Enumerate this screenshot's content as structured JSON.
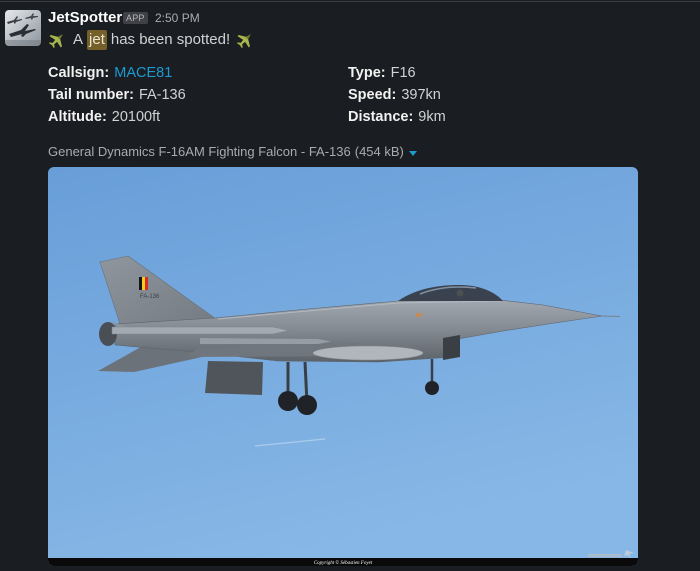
{
  "app": {
    "name": "JetSpotter",
    "badge": "APP",
    "time": "2:50 PM",
    "avatar_icon": "jets-avatar-icon"
  },
  "message": {
    "prefix": "A",
    "highlight": "jet",
    "suffix": "has been spotted!",
    "icon": "airplane-icon"
  },
  "fields": {
    "callsign": {
      "label": "Callsign:",
      "value": "MACE81"
    },
    "tail_number": {
      "label": "Tail number:",
      "value": "FA-136"
    },
    "altitude": {
      "label": "Altitude:",
      "value": "20100ft"
    },
    "type": {
      "label": "Type:",
      "value": "F16"
    },
    "speed": {
      "label": "Speed:",
      "value": "397kn"
    },
    "distance": {
      "label": "Distance:",
      "value": "9km"
    }
  },
  "attachment": {
    "title": "General Dynamics F-16AM Fighting Falcon - FA-136",
    "size": "(454 kB)",
    "toggle_icon": "caret-down-icon"
  },
  "photo": {
    "tail_marking": "FA-136",
    "copyright": "Copyright © Sébastien Foyet"
  },
  "colors": {
    "background": "#1a1d21",
    "link": "#1d9bd1",
    "highlight": "#75602a",
    "sky": "#6ca2db"
  }
}
